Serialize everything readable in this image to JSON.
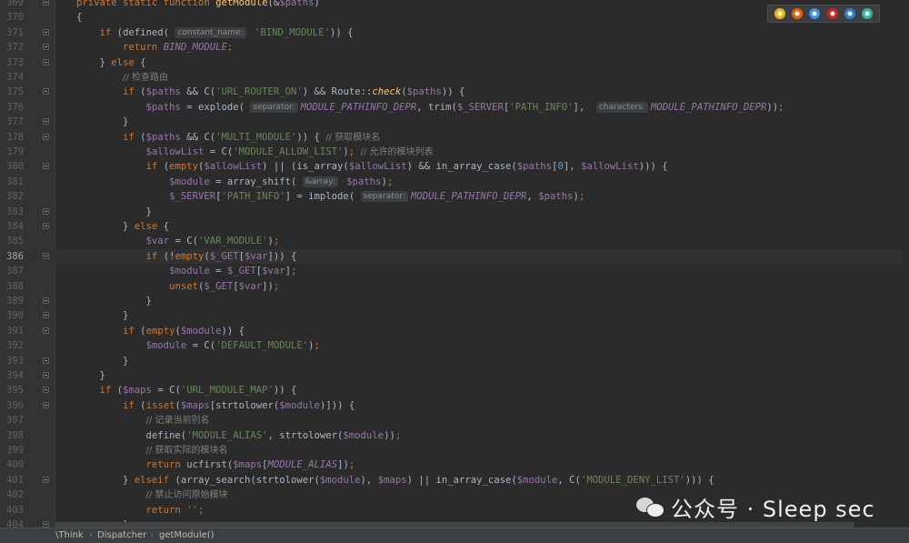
{
  "window": {
    "title": "getModule"
  },
  "lines": [
    {
      "n": "369",
      "html": "<span class=\"kw\">private static function </span><span class=\"fn\">getModule</span>(&amp;<span class=\"var\">$paths</span>)"
    },
    {
      "n": "370",
      "html": "{"
    },
    {
      "n": "371",
      "html": "    <span class=\"kw\">if</span> (defined( <span class=\"hint\">constant_name:</span> <span class=\"str\">'BIND_MODULE'</span>)) {"
    },
    {
      "n": "372",
      "html": "        <span class=\"kw\">return</span> <span class=\"const\">BIND_MODULE</span><span class=\"kw\">;</span>"
    },
    {
      "n": "373",
      "html": "    } <span class=\"kw\">else</span> {"
    },
    {
      "n": "374",
      "html": "        <span class=\"cm\">// 检查路由</span>"
    },
    {
      "n": "375",
      "html": "        <span class=\"kw\">if</span> (<span class=\"var\">$paths</span> &amp;&amp; C(<span class=\"str\">'URL_ROUTER_ON'</span>) &amp;&amp; Route::<span class=\"call-i\">check</span>(<span class=\"var\">$paths</span>)) {"
    },
    {
      "n": "376",
      "html": "            <span class=\"var\">$paths</span> = explode( <span class=\"hint\">separator:</span><span class=\"const\">MODULE_PATHINFO_DEPR</span>, trim(<span class=\"var\">$_SERVER</span>[<span class=\"str\">'PATH_INFO'</span>],  <span class=\"hint\">characters:</span><span class=\"const\">MODULE_PATHINFO_DEPR</span>))<span class=\"kw\">;</span>"
    },
    {
      "n": "377",
      "html": "        }"
    },
    {
      "n": "378",
      "html": "        <span class=\"kw\">if</span> (<span class=\"var\">$paths</span> &amp;&amp; C(<span class=\"str\">'MULTI_MODULE'</span>)) { <span class=\"cm\">// 获取模块名</span>"
    },
    {
      "n": "379",
      "html": "            <span class=\"var\">$allowList</span> = C(<span class=\"str\">'MODULE_ALLOW_LIST'</span>)<span class=\"kw\">;</span> <span class=\"cm\">// 允许的模块列表</span>"
    },
    {
      "n": "380",
      "html": "            <span class=\"kw\">if</span> (<span class=\"kw\">empty</span>(<span class=\"var\">$allowList</span>) || (is_array(<span class=\"var\">$allowList</span>) &amp;&amp; in_array_case(<span class=\"var\">$paths</span>[<span class=\"num\">0</span>], <span class=\"var\">$allowList</span>))) {"
    },
    {
      "n": "381",
      "html": "                <span class=\"var\">$module</span> = array_shift( <span class=\"hint\">&amp;array:</span> <span class=\"var\">$paths</span>)<span class=\"kw\">;</span>"
    },
    {
      "n": "382",
      "html": "                <span class=\"var\">$_SERVER</span>[<span class=\"str\">'PATH_INFO'</span>] = implode( <span class=\"hint\">separator:</span><span class=\"const\">MODULE_PATHINFO_DEPR</span>, <span class=\"var\">$paths</span>)<span class=\"kw\">;</span>"
    },
    {
      "n": "383",
      "html": "            }"
    },
    {
      "n": "384",
      "html": "        } <span class=\"kw\">else</span> {"
    },
    {
      "n": "385",
      "html": "            <span class=\"var\">$var</span> = C(<span class=\"str\">'VAR_MODULE'</span>)<span class=\"kw\">;</span>"
    },
    {
      "n": "386",
      "html": "            <span class=\"kw\">if</span> (!<span class=\"kw\">empty</span>(<span class=\"var\">$_GET</span>[<span class=\"var\">$var</span>])) {",
      "current": true
    },
    {
      "n": "387",
      "html": "                <span class=\"var\">$module</span> = <span class=\"var\">$_GET</span>[<span class=\"var\">$var</span>]<span class=\"kw\">;</span>"
    },
    {
      "n": "388",
      "html": "                <span class=\"kw\">unset</span>(<span class=\"var\">$_GET</span>[<span class=\"var\">$var</span>])<span class=\"kw\">;</span>"
    },
    {
      "n": "389",
      "html": "            }"
    },
    {
      "n": "390",
      "html": "        }"
    },
    {
      "n": "391",
      "html": "        <span class=\"kw\">if</span> (<span class=\"kw\">empty</span>(<span class=\"var\">$module</span>)) {"
    },
    {
      "n": "392",
      "html": "            <span class=\"var\">$module</span> = C(<span class=\"str\">'DEFAULT_MODULE'</span>)<span class=\"kw\">;</span>"
    },
    {
      "n": "393",
      "html": "        }"
    },
    {
      "n": "394",
      "html": "    }"
    },
    {
      "n": "395",
      "html": "    <span class=\"kw\">if</span> (<span class=\"var\">$maps</span> = C(<span class=\"str\">'URL_MODULE_MAP'</span>)) {"
    },
    {
      "n": "396",
      "html": "        <span class=\"kw\">if</span> (<span class=\"kw\">isset</span>(<span class=\"var\">$maps</span>[strtolower(<span class=\"var\">$module</span>)])) {"
    },
    {
      "n": "397",
      "html": "            <span class=\"cm\">// 记录当前别名</span>"
    },
    {
      "n": "398",
      "html": "            define(<span class=\"str\">'MODULE_ALIAS'</span>, strtolower(<span class=\"var\">$module</span>))<span class=\"kw\">;</span>"
    },
    {
      "n": "399",
      "html": "            <span class=\"cm\">// 获取实际的模块名</span>"
    },
    {
      "n": "400",
      "html": "            <span class=\"kw\">return</span> ucfirst(<span class=\"var\">$maps</span>[<span class=\"const\">MODULE_ALIAS</span>])<span class=\"kw\">;</span>"
    },
    {
      "n": "401",
      "html": "        } <span class=\"kw\">elseif</span> (array_search(strtolower(<span class=\"var\">$module</span>), <span class=\"var\">$maps</span>) || in_array_case(<span class=\"var\">$module</span>, C(<span class=\"str\">'MODULE_DENY_LIST'</span>))) {"
    },
    {
      "n": "402",
      "html": "            <span class=\"cm\">// 禁止访问原始模块</span>"
    },
    {
      "n": "403",
      "html": "            <span class=\"kw\">return</span> <span class=\"str\">''</span><span class=\"kw\">;</span>"
    },
    {
      "n": "404",
      "html": "        }"
    }
  ],
  "fold_markers": [
    "369",
    "371",
    "372",
    "373",
    "375",
    "377",
    "378",
    "380",
    "383",
    "384",
    "386",
    "389",
    "390",
    "391",
    "393",
    "394",
    "395",
    "396",
    "401",
    "404"
  ],
  "browsers": [
    {
      "name": "chrome-icon",
      "color": "#e8b40c"
    },
    {
      "name": "firefox-icon",
      "color": "#e66000"
    },
    {
      "name": "safari-icon",
      "color": "#3a8ee6"
    },
    {
      "name": "opera-icon",
      "color": "#d71e1e"
    },
    {
      "name": "ie-icon",
      "color": "#2a7fd4"
    },
    {
      "name": "edge-icon",
      "color": "#2fb5a5"
    }
  ],
  "breadcrumb": [
    "\\Think",
    "Dispatcher",
    "getModule()"
  ],
  "watermark": {
    "text": "公众号 · Sleep sec"
  }
}
